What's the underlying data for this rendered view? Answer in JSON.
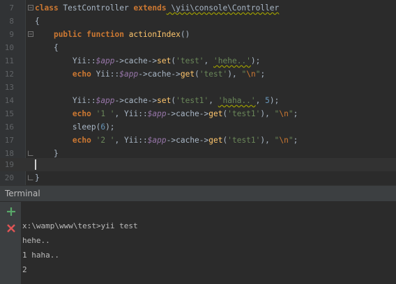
{
  "editor": {
    "line_numbers": [
      "7",
      "8",
      "9",
      "10",
      "11",
      "12",
      "13",
      "14",
      "15",
      "16",
      "17",
      "18",
      "19",
      "20"
    ],
    "line7": {
      "kw_class": "class",
      "class_name": " TestController ",
      "kw_extends": "extends",
      "parent": " \\yii\\console\\Controller"
    },
    "line8": {
      "text": "{"
    },
    "line9": {
      "kw_public": "public",
      "kw_function": " function ",
      "fn_name": "actionIndex",
      "rest": "()"
    },
    "line10": {
      "text": "{"
    },
    "line11": {
      "p1": "Yii::",
      "var": "$app",
      "p2": "->cache->",
      "fn": "set",
      "p3": "(",
      "s1": "'test'",
      "p4": ", ",
      "s2": "'hehe..'",
      "p5": ");"
    },
    "line12": {
      "kw": "echo",
      "p1": " Yii::",
      "var": "$app",
      "p2": "->cache->",
      "fn": "get",
      "p3": "(",
      "s1": "'test'",
      "p4": "), ",
      "s2": "\"",
      "esc": "\\n",
      "s3": "\"",
      "p5": ";"
    },
    "line14": {
      "p1": "Yii::",
      "var": "$app",
      "p2": "->cache->",
      "fn": "set",
      "p3": "(",
      "s1": "'test1'",
      "p4": ", ",
      "s2": "'haha..'",
      "p5": ", ",
      "num": "5",
      "p6": ");"
    },
    "line15": {
      "kw": "echo",
      "s0": " '1 '",
      "p1": ", Yii::",
      "var": "$app",
      "p2": "->cache->",
      "fn": "get",
      "p3": "(",
      "s1": "'test1'",
      "p4": "), ",
      "s2": "\"",
      "esc": "\\n",
      "s3": "\"",
      "p5": ";"
    },
    "line16": {
      "p1": "sleep(",
      "num": "6",
      "p2": ");"
    },
    "line17": {
      "kw": "echo",
      "s0": " '2 '",
      "p1": ", Yii::",
      "var": "$app",
      "p2": "->cache->",
      "fn": "get",
      "p3": "(",
      "s1": "'test1'",
      "p4": "), ",
      "s2": "\"",
      "esc": "\\n",
      "s3": "\"",
      "p5": ";"
    },
    "line18": {
      "text": "}"
    },
    "line20": {
      "text": "}"
    }
  },
  "terminal": {
    "title": "Terminal",
    "icons": {
      "add": "plus-icon",
      "close": "close-icon"
    },
    "colors": {
      "add": "#59a869",
      "close": "#e05555"
    },
    "lines": [
      "x:\\wamp\\www\\test>yii test",
      "hehe..",
      "1 haha..",
      "2"
    ]
  }
}
